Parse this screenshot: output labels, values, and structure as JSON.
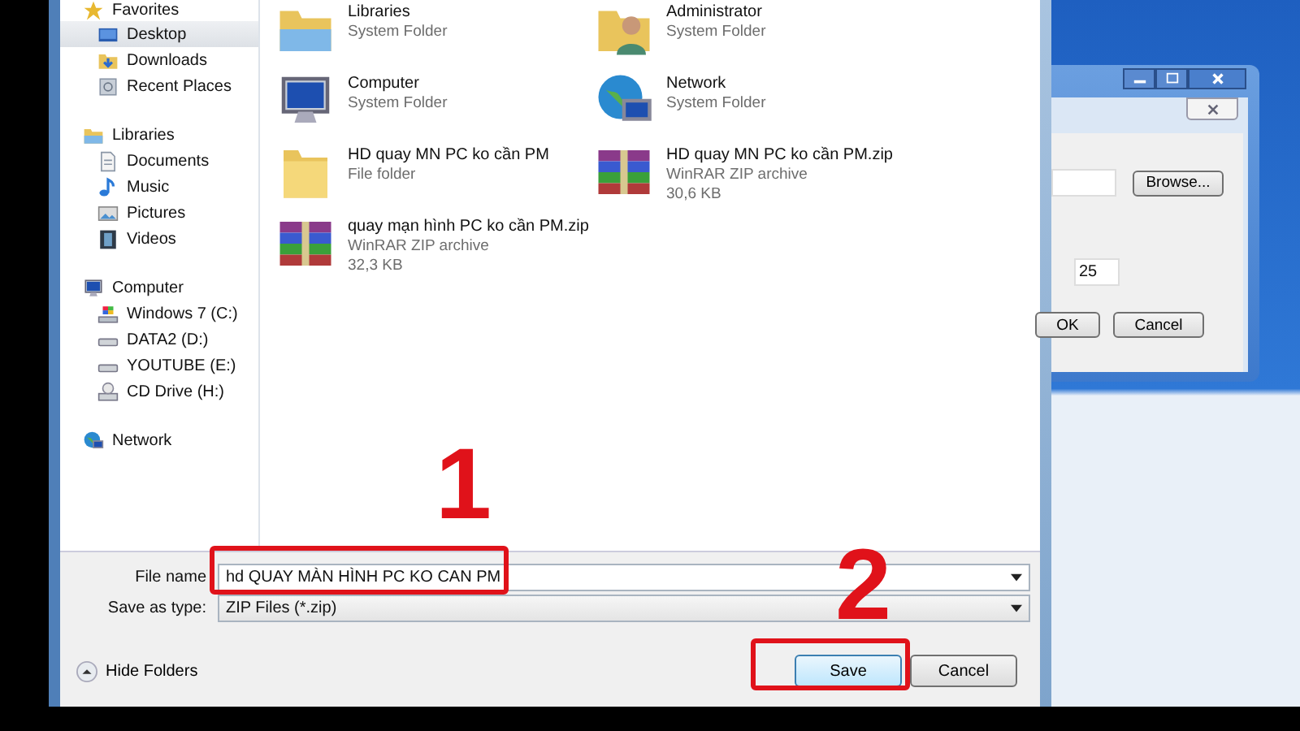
{
  "dialog": {
    "sidebar": [
      {
        "label": "Favorites",
        "kind": "star",
        "selected": false,
        "children": [
          {
            "label": "Desktop",
            "kind": "desktop",
            "selected": true
          },
          {
            "label": "Downloads",
            "kind": "downloads",
            "selected": false
          },
          {
            "label": "Recent Places",
            "kind": "recent",
            "selected": false
          }
        ]
      },
      {
        "label": "Libraries",
        "kind": "libraries",
        "selected": false,
        "children": [
          {
            "label": "Documents",
            "kind": "document",
            "selected": false
          },
          {
            "label": "Music",
            "kind": "music",
            "selected": false
          },
          {
            "label": "Pictures",
            "kind": "pictures",
            "selected": false
          },
          {
            "label": "Videos",
            "kind": "videos",
            "selected": false
          }
        ]
      },
      {
        "label": "Computer",
        "kind": "computer",
        "selected": false,
        "children": [
          {
            "label": "Windows 7 (C:)",
            "kind": "windrive",
            "selected": false
          },
          {
            "label": "DATA2 (D:)",
            "kind": "drive",
            "selected": false
          },
          {
            "label": "YOUTUBE (E:)",
            "kind": "drive",
            "selected": false
          },
          {
            "label": "CD Drive (H:)",
            "kind": "cd",
            "selected": false
          }
        ]
      },
      {
        "label": "Network",
        "kind": "network",
        "selected": false
      }
    ],
    "files": [
      {
        "name": "Libraries",
        "type": "System Folder",
        "kind": "libraries"
      },
      {
        "name": "Administrator",
        "type": "System Folder",
        "kind": "user"
      },
      {
        "name": "Computer",
        "type": "System Folder",
        "kind": "computer"
      },
      {
        "name": "Network",
        "type": "System Folder",
        "kind": "network"
      },
      {
        "name": "HD quay MN PC ko cần PM",
        "type": "File folder",
        "kind": "folder"
      },
      {
        "name": "HD quay MN PC ko cần PM.zip",
        "type": "WinRAR ZIP archive",
        "size": "30,6 KB",
        "kind": "zip"
      },
      {
        "name": "quay mạn hình PC ko cần PM.zip",
        "type": "WinRAR ZIP archive",
        "size": "32,3 KB",
        "kind": "zip"
      }
    ],
    "file_name": {
      "label": "File name",
      "value": "hd QUAY MÀN HÌNH PC KO CAN PM"
    },
    "save_as_type": {
      "label": "Save as type:",
      "value": "ZIP Files (*.zip)"
    },
    "hide_folders": "Hide Folders",
    "buttons": [
      "Save",
      "Cancel"
    ]
  },
  "background_window": {
    "browse": "Browse...",
    "number": "25",
    "buttons": [
      "OK",
      "Cancel"
    ]
  },
  "annotations": [
    "1",
    "2"
  ]
}
